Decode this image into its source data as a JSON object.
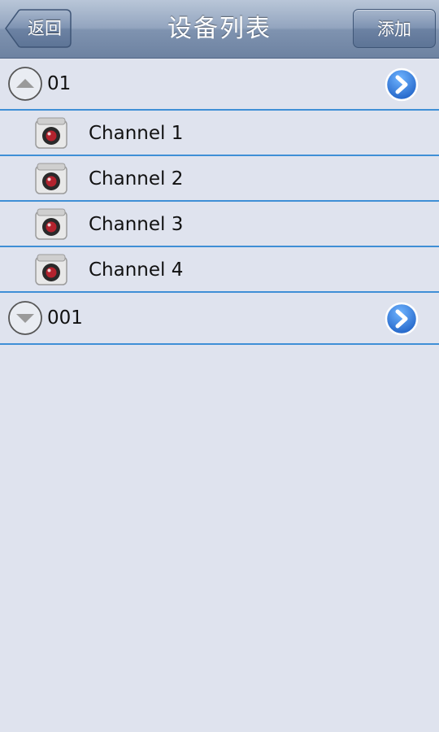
{
  "navbar": {
    "title": "设备列表",
    "back_label": "返回",
    "add_label": "添加"
  },
  "groups": [
    {
      "label": "01",
      "expanded": true,
      "channels": [
        "Channel 1",
        "Channel 2",
        "Channel 3",
        "Channel 4"
      ]
    },
    {
      "label": "001",
      "expanded": false,
      "channels": []
    }
  ],
  "icons": {
    "expand": "chevron-up-circle-icon",
    "collapse": "chevron-down-circle-icon",
    "detail": "blue-chevron-right-icon",
    "channel": "camera-icon"
  },
  "colors": {
    "background": "#dfe3ee",
    "separator": "#3f8fd6",
    "detail_button": "#2f78d8"
  }
}
